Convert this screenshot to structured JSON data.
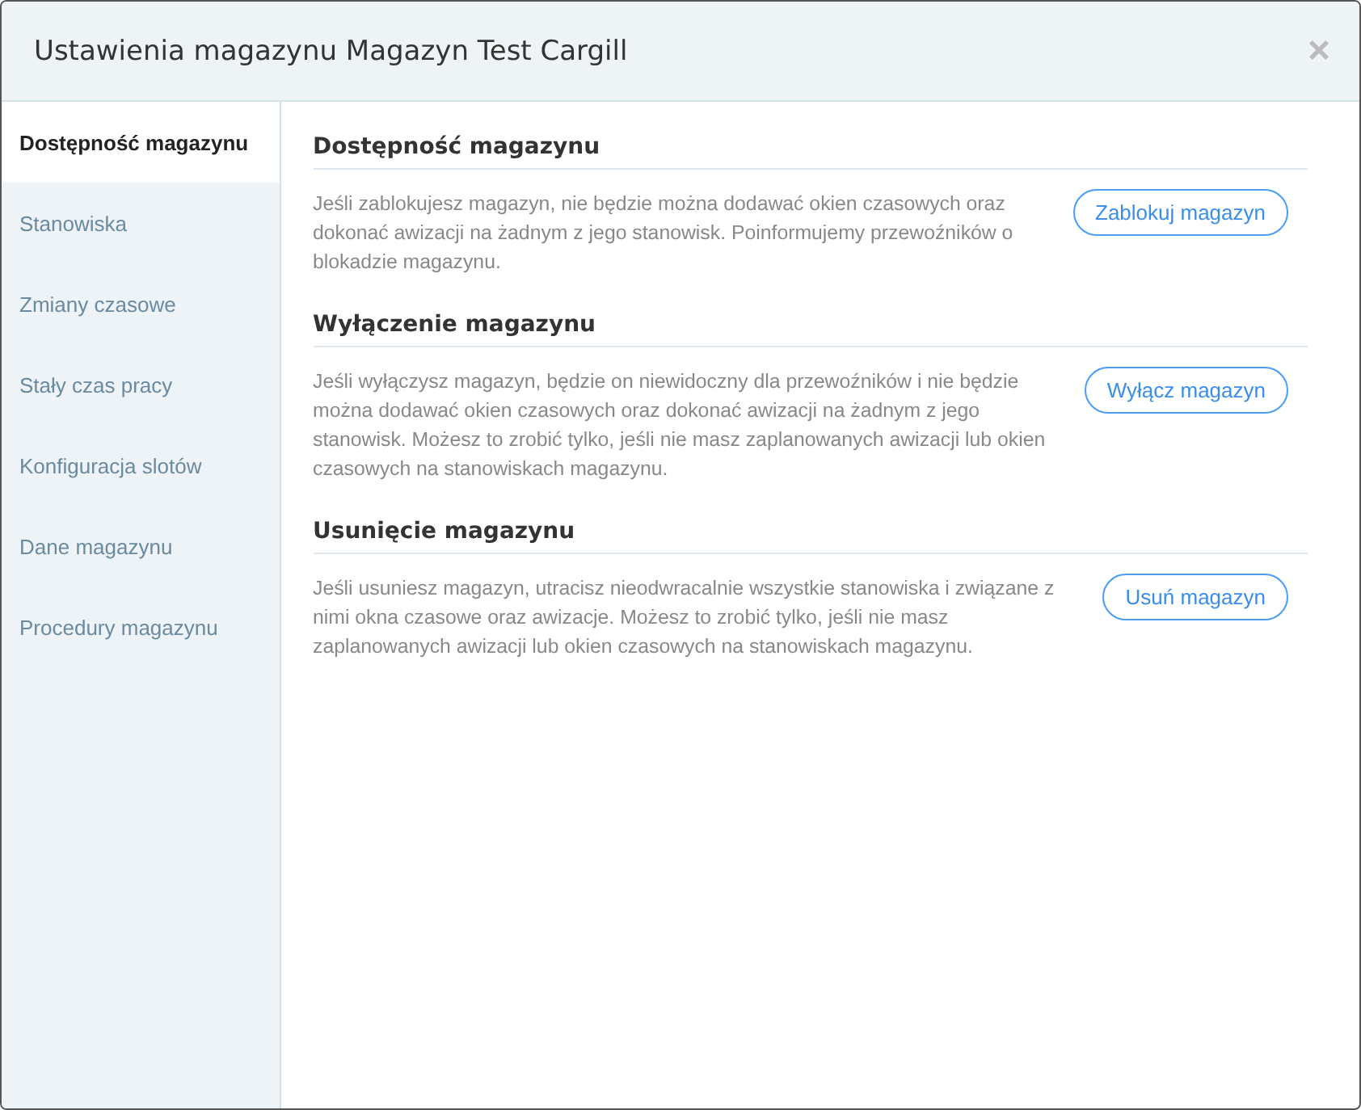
{
  "window": {
    "title": "Ustawienia magazynu Magazyn Test Cargill",
    "close": "×"
  },
  "sidebar": {
    "items": [
      {
        "label": "Dostępność magazynu",
        "selected": true
      },
      {
        "label": "Stanowiska",
        "selected": false
      },
      {
        "label": "Zmiany czasowe",
        "selected": false
      },
      {
        "label": "Stały czas pracy",
        "selected": false
      },
      {
        "label": "Konfiguracja slotów",
        "selected": false
      },
      {
        "label": "Dane magazynu",
        "selected": false
      },
      {
        "label": "Procedury magazynu",
        "selected": false
      }
    ]
  },
  "sections": [
    {
      "heading": "Dostępność magazynu",
      "text": "Jeśli zablokujesz magazyn, nie będzie można dodawać okien czasowych oraz dokonać awizacji na żadnym z jego stanowisk. Poinformujemy przewoźników o blokadzie magazynu.",
      "button": "Zablokuj magazyn"
    },
    {
      "heading": "Wyłączenie magazynu",
      "text": "Jeśli wyłączysz magazyn, będzie on niewidoczny dla przewoźników i nie będzie można dodawać okien czasowych oraz dokonać awizacji na żadnym z jego stanowisk. Możesz to zrobić tylko, jeśli nie masz zaplanowanych awizacji lub okien czasowych na stanowiskach magazynu.",
      "button": "Wyłącz magazyn"
    },
    {
      "heading": "Usunięcie magazynu",
      "text": "Jeśli usuniesz magazyn, utracisz nieodwracalnie wszystkie stanowiska i związane z nimi okna czasowe oraz awizacje. Możesz to zrobić tylko, jeśli nie masz zaplanowanych awizacji lub okien czasowych na stanowiskach magazynu.",
      "button": "Usuń magazyn"
    }
  ]
}
